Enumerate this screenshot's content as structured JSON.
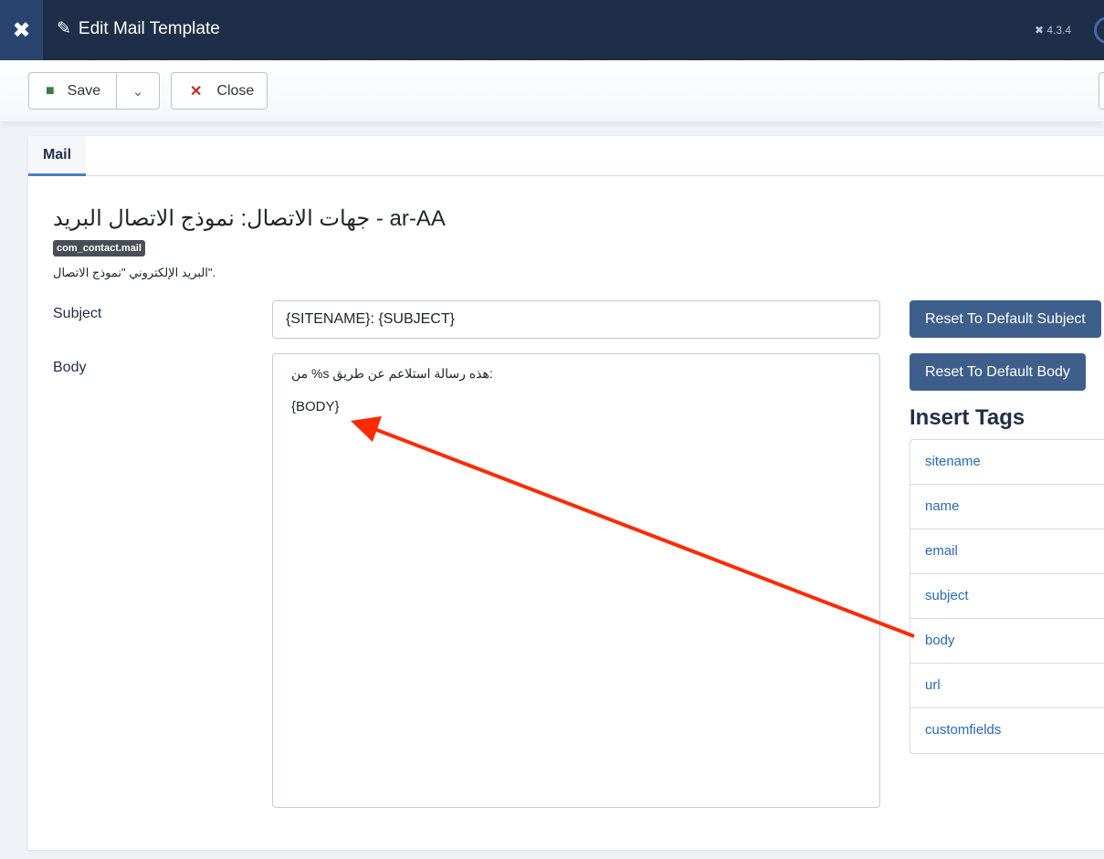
{
  "header": {
    "title": "Edit Mail Template",
    "version": "4.3.4"
  },
  "toolbar": {
    "save": "Save",
    "close": "Close"
  },
  "tabs": [
    {
      "label": "Mail"
    }
  ],
  "template": {
    "title": "جهات الاتصال: نموذج الاتصال البريد - ar-AA",
    "id_badge": "com_contact.mail",
    "description": "البريد الإلكتروني \"نموذج الاتصال\"."
  },
  "form": {
    "subject_label": "Subject",
    "subject_value": "{SITENAME}: {SUBJECT}",
    "body_label": "Body",
    "body_line1": "من %s هذه رسالة استلاعم عن طريق:",
    "body_line2": "{BODY}",
    "reset_subject": "Reset To Default Subject",
    "reset_body": "Reset To Default Body"
  },
  "insert_tags": {
    "title": "Insert Tags",
    "items": [
      "sitename",
      "name",
      "email",
      "subject",
      "body",
      "url",
      "customfields"
    ]
  },
  "annotation": {
    "color": "#ff2a00"
  }
}
